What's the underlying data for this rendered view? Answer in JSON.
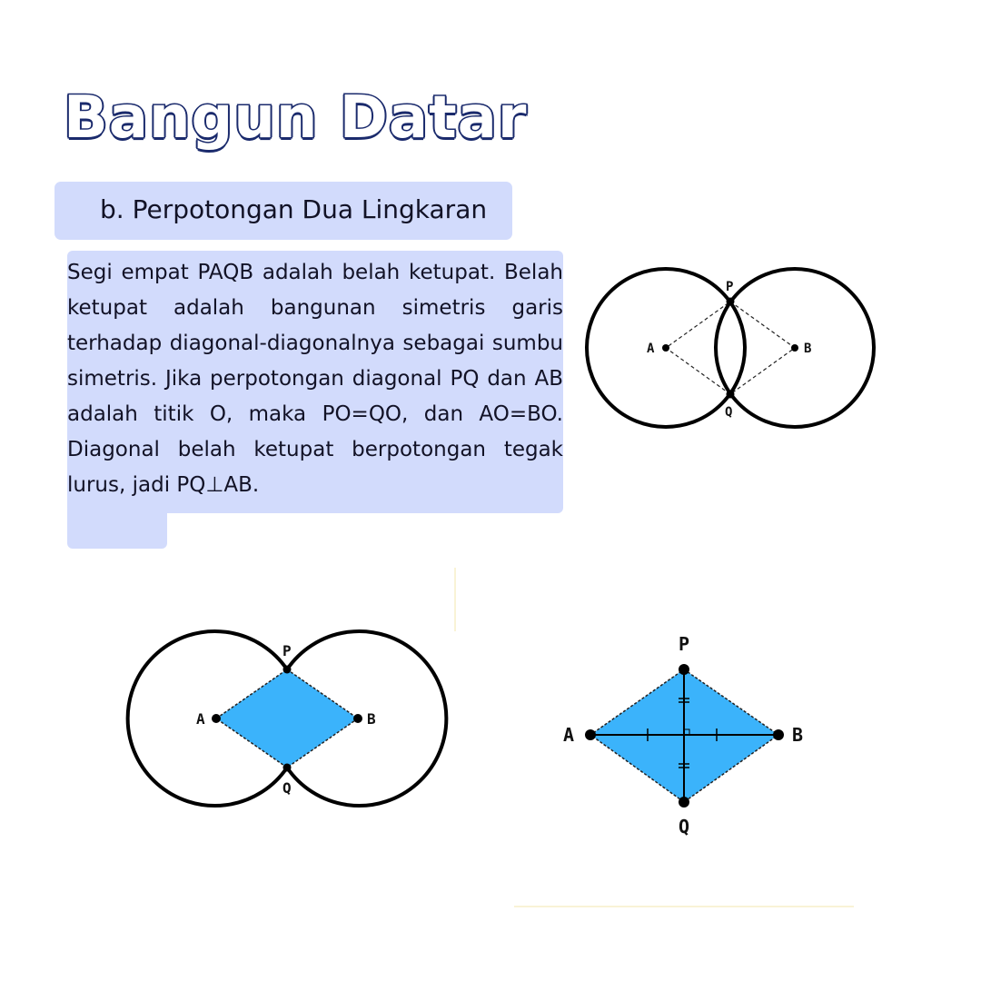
{
  "title": "Bangun Datar",
  "subtitle": "b. Perpotongan Dua Lingkaran",
  "paragraph": "Segi empat PAQB adalah belah ketupat. Belah ketupat adalah bangunan simetris garis terhadap diagonal-diagonalnya sebagai sumbu simetris. Jika perpotongan diagonal PQ dan AB adalah titik O, maka PO=QO, dan AO=BO. Diagonal belah ketupat berpotongan tegak lurus, jadi PQ⊥AB.",
  "colors": {
    "title_outline": "#1a2a6c",
    "highlight": "#d2dbfc",
    "rhombus_fill": "#3bb3fb"
  },
  "diagrams": {
    "labels": {
      "P": "P",
      "Q": "Q",
      "A": "A",
      "B": "B"
    }
  }
}
